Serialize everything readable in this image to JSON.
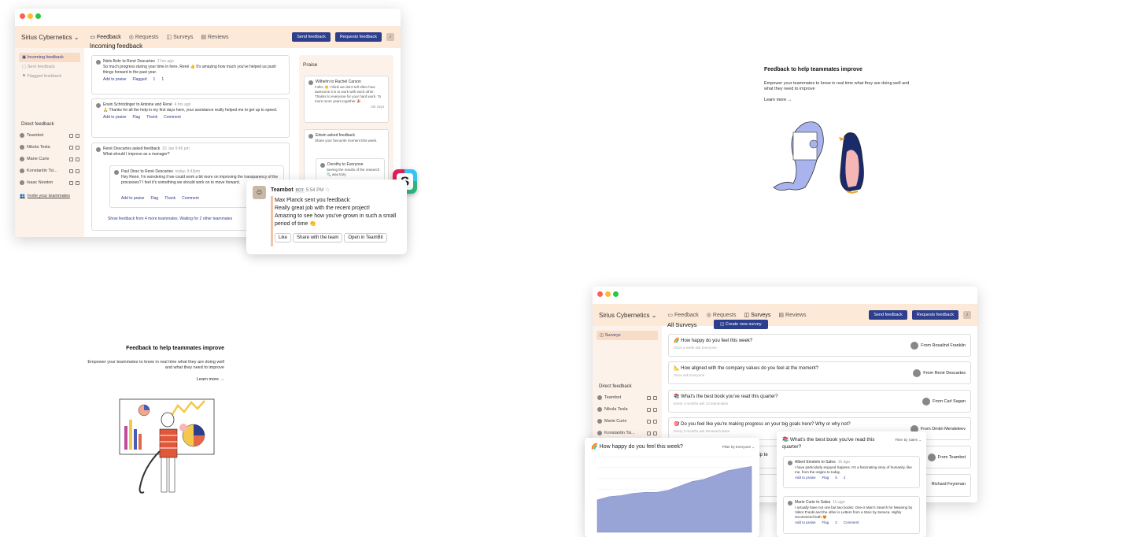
{
  "w1": {
    "brand": "Sirius Cybernetics",
    "nav": [
      "Feedback",
      "Requests",
      "Surveys",
      "Reviews"
    ],
    "send_btn": "Send feedback",
    "req_btn": "Requests feedback",
    "sidebar": [
      "Incoming feedback",
      "Sent feedback",
      "Flagged feedback"
    ],
    "direct_header": "Direct feedback",
    "direct": [
      "Teambot",
      "Nikola Tesla",
      "Marie Curie",
      "Konstantin Tsi...",
      "Isaac Newton"
    ],
    "invite": "Invite your teammates",
    "title": "Incoming feedback",
    "cards": [
      {
        "who": "Niels Bohr to René Descartes",
        "time": "2 hrs ago",
        "body": "So much progress during your time in here, René 👍 It's amazing how much you've helped us push things forward in the past year.",
        "a1": "Add to praise",
        "a2": "Flagged",
        "c1": "1",
        "c2": "1"
      },
      {
        "who": "Erwin Schrödinger to Antoine and René",
        "time": "4 hrs ago",
        "body": "🙏 Thanks for all the help in my first days here, your assistance really helped me to get up to speed.",
        "a1": "Add to praise",
        "a2": "Flag",
        "a3": "Thank",
        "a4": "Comment"
      },
      {
        "who": "René Descartes asked feedback",
        "time": "22 Jan 9:45 pm",
        "body": "What should I improve as a manager?",
        "foot": "Show feedback from 4 more teammates. Waiting for 2 other teammates"
      }
    ],
    "reply": {
      "who": "Paul Dirac to René Descartes",
      "time": "today, 9:43pm",
      "body": "Hey René, I'm wondering if we could work a bit more on improving the transparency of the processes? I feel it's something we should work on to move forward.",
      "a1": "Add to praise",
      "a2": "Flag",
      "a3": "Thank",
      "a4": "Comment"
    },
    "praise_title": "Praise",
    "praise": {
      "who": "Wilhelm to Rachel Carson",
      "body": "Folks 👏 I think we don't tell often how awesome it is to work with each other. Thanks to everyone for your hard work. To more more years together 🎉",
      "time": "5th Sept"
    },
    "ask": {
      "who": "Edwin asked feedback",
      "body": "Share your favourite moment this week.",
      "sub_who": "Dorothy to Everyone",
      "sub_body": "Seeing the results of the research 🔍 was truly"
    }
  },
  "slack": {
    "name": "Teambot",
    "bot": "BOT",
    "time": "5:54 PM",
    "l1": "Max Planck sent you feedback:",
    "l2": "Really great job with the recent project!",
    "l3": "Amazing to see how you've grown in such a small period of time 👏",
    "b1": "Like",
    "b2": "Share with the team",
    "b3": "Open in TeamBit"
  },
  "promo1": {
    "title": "Feedback to help teammates improve",
    "body": "Empower your teammates to know in real time what they are doing well and what they need to improve",
    "link": "Learn more →"
  },
  "promo2": {
    "title": "Feedback to help teammates improve",
    "body": "Empower your teammates to know in real time what they are doing well and what they need to improve",
    "link": "Learn more →"
  },
  "w2": {
    "brand": "Sirius Cybernetics",
    "nav": [
      "Feedback",
      "Requests",
      "Surveys",
      "Reviews"
    ],
    "send_btn": "Send feedback",
    "req_btn": "Requests feedback",
    "side_item": "Surveys",
    "title": "All Surveys",
    "create": "Create new survey",
    "direct_header": "Direct feedback",
    "direct": [
      "Teambot",
      "Nikola Tesla",
      "Marie Curie",
      "Konstantin Tsi..."
    ],
    "surveys": [
      {
        "q": "🌈 How happy do you feel this week?",
        "sub": "Once a week ask Everyone",
        "from": "From Rosalind Franklin"
      },
      {
        "q": "📐 How aligned with the company values do you feel at the moment?",
        "sub": "Once ask Everyone",
        "from": "From René Descartes"
      },
      {
        "q": "📚 What's the best book you've read this quarter?",
        "sub": "Every 3 months ask 12 teammates",
        "from": "From Carl Sagan"
      },
      {
        "q": "🎯 Do you feel like you're making progress on your big goals here? Why or why not?",
        "sub": "Every 3 months ask Research team",
        "from": "From Dmitri Mendeleev"
      },
      {
        "q": "rship te",
        "sub": "",
        "from": "From Teambot"
      },
      {
        "q": "",
        "sub": "",
        "from": "Richard Feynman"
      }
    ]
  },
  "chartpanel": {
    "title": "🌈 How happy do you feel this week?",
    "filter": "Filter by Everyone ⌄"
  },
  "bookpanel": {
    "title": "📚 What's the best book you've read this quarter?",
    "filter": "Filter by Sales ⌄",
    "c1": {
      "who": "Albert Einstein to Sales",
      "time": "1h ago",
      "body": "I have particularly enjoyed Sapiens. It's a fascinating story of humanity, like me, from the origins to today.",
      "a1": "Add to praise",
      "a2": "Flag",
      "c1": "5",
      "c2": "2"
    },
    "c2": {
      "who": "Marie Curie to Sales",
      "time": "1h ago",
      "body": "I actually have not one but two books: One is Man's Search for Meaning by Viktor Frankl and the other is Letters from a Stoic by Seneca. Highly recommend both 😍",
      "a1": "Add to praise",
      "a2": "Flag",
      "c1": "2",
      "c2": "Comment"
    }
  },
  "chart_data": {
    "type": "area",
    "title": "🌈 How happy do you feel this week?",
    "y": [
      3.0,
      3.3,
      3.4,
      3.6,
      3.7,
      3.7,
      3.9,
      4.3,
      4.7,
      4.9,
      5.3,
      5.7,
      5.9,
      6.1
    ],
    "ylim": [
      0,
      7
    ],
    "color": "#98a3d6"
  }
}
